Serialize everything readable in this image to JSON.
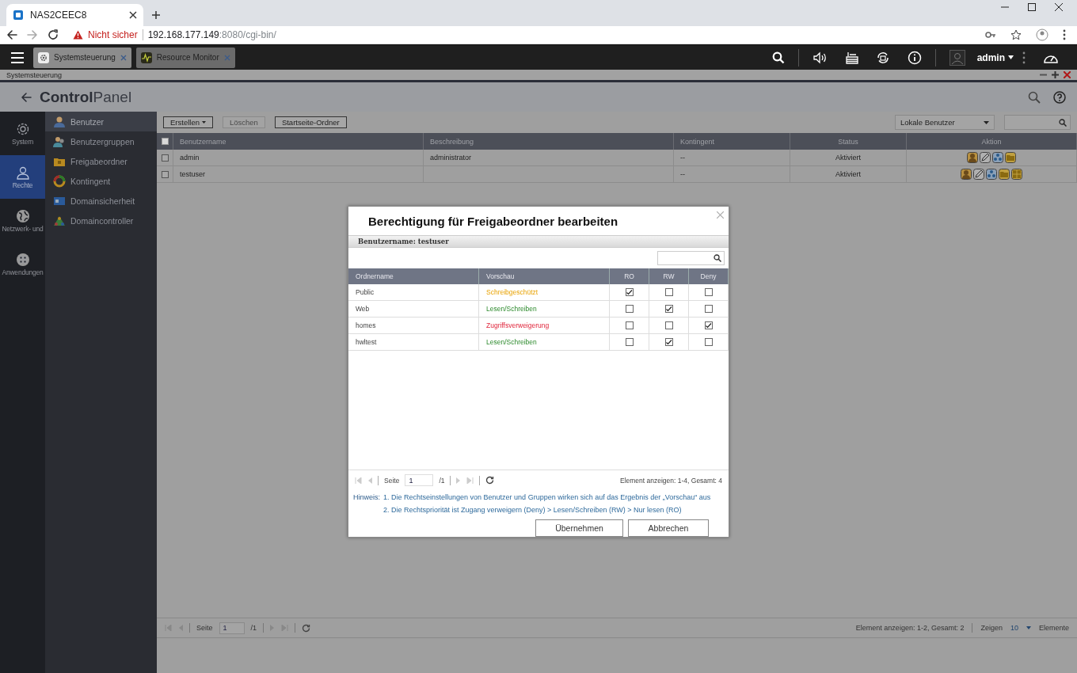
{
  "browser": {
    "tab_title": "NAS2CEEC8",
    "security": "Nicht sicher",
    "url_host": "192.168.177.149",
    "url_rest": ":8080/cgi-bin/"
  },
  "taskbar": {
    "apps": [
      {
        "label": "Systemsteuerung",
        "kind": "gear",
        "selected": true
      },
      {
        "label": "Resource Monitor",
        "kind": "monitor",
        "selected": false
      }
    ],
    "user": "admin"
  },
  "window_title": "Systemsteuerung",
  "header": {
    "title_bold": "Control",
    "title_light": "Panel"
  },
  "nav": [
    {
      "label": "System",
      "kind": "gear",
      "selected": false
    },
    {
      "label": "Rechte",
      "kind": "user",
      "selected": true
    },
    {
      "label": "Netzwerk- und",
      "kind": "globe",
      "selected": false
    },
    {
      "label": "Anwendungen",
      "kind": "apps",
      "selected": false
    }
  ],
  "subnav": [
    {
      "label": "Benutzer",
      "kind": "user",
      "selected": true
    },
    {
      "label": "Benutzergruppen",
      "kind": "group",
      "selected": false
    },
    {
      "label": "Freigabeordner",
      "kind": "folder",
      "selected": false
    },
    {
      "label": "Kontingent",
      "kind": "quota",
      "selected": false
    },
    {
      "label": "Domainsicherheit",
      "kind": "domain",
      "selected": false
    },
    {
      "label": "Domaincontroller",
      "kind": "controller",
      "selected": false
    }
  ],
  "toolbar": {
    "buttons": [
      {
        "label": "Erstellen",
        "dropdown": true,
        "disabled": false
      },
      {
        "label": "Löschen",
        "dropdown": false,
        "disabled": true
      },
      {
        "label": "Startseite-Ordner",
        "dropdown": false,
        "disabled": false
      }
    ],
    "filter": "Lokale Benutzer"
  },
  "users": {
    "all_checked": false,
    "columns": [
      "Benutzername",
      "Beschreibung",
      "Kontingent",
      "Status",
      "Aktion"
    ],
    "rows": [
      {
        "checked": false,
        "name": "admin",
        "description": "administrator",
        "quota": "--",
        "status": "Aktiviert",
        "actions": [
          {
            "kind": "profile"
          },
          {
            "kind": "edit"
          },
          {
            "kind": "group"
          },
          {
            "kind": "folder"
          }
        ]
      },
      {
        "checked": false,
        "name": "testuser",
        "description": "",
        "quota": "--",
        "status": "Aktiviert",
        "actions": [
          {
            "kind": "profile"
          },
          {
            "kind": "edit"
          },
          {
            "kind": "group"
          },
          {
            "kind": "folder"
          },
          {
            "kind": "apps"
          }
        ]
      }
    ]
  },
  "pager": {
    "page_label": "Seite",
    "page": "1",
    "total": "/1",
    "info": "Element anzeigen: 1-2, Gesamt: 2",
    "show_label": "Zeigen",
    "per_page": "10",
    "items_label": "Elemente"
  },
  "dialog": {
    "title": "Berechtigung für Freigabeordner bearbeiten",
    "subtitle": "Benutzername: testuser",
    "columns": [
      "Ordnername",
      "Vorschau",
      "RO",
      "RW",
      "Deny"
    ],
    "rows": [
      {
        "name": "Public",
        "preview": "Schreibgeschützt",
        "kind": "readonly",
        "ro": true,
        "rw": false,
        "deny": false
      },
      {
        "name": "Web",
        "preview": "Lesen/Schreiben",
        "kind": "readwrite",
        "ro": false,
        "rw": true,
        "deny": false
      },
      {
        "name": "homes",
        "preview": "Zugriffsverweigerung",
        "kind": "deny",
        "ro": false,
        "rw": false,
        "deny": true
      },
      {
        "name": "hwltest",
        "preview": "Lesen/Schreiben",
        "kind": "readwrite",
        "ro": false,
        "rw": true,
        "deny": false
      }
    ],
    "pager": {
      "page_label": "Seite",
      "page": "1",
      "total": "/1",
      "info": "Element anzeigen: 1-4, Gesamt: 4"
    },
    "hint_label": "Hinweis:",
    "hints": [
      "1. Die Rechtseinstellungen von Benutzer und Gruppen wirken sich auf das Ergebnis der „Vorschau“ aus",
      "2. Die Rechtspriorität ist Zugang verweigern (Deny) > Lesen/Schreiben (RW) > Nur lesen (RO)"
    ],
    "buttons": [
      "Übernehmen",
      "Abbrechen"
    ]
  }
}
